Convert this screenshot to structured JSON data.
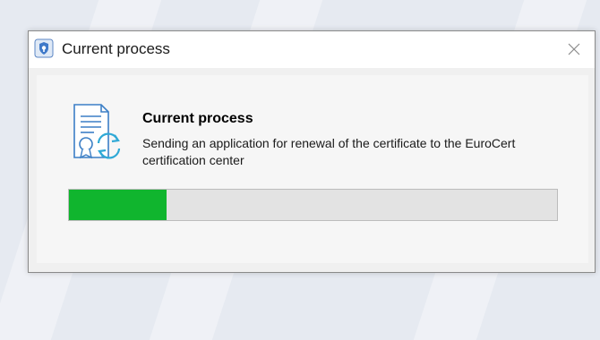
{
  "window": {
    "title": "Current process",
    "icon": "app-shield-icon"
  },
  "content": {
    "heading": "Current process",
    "message": "Sending an application for renewal of the certificate to the EuroCert certification center",
    "icon": "certificate-renew-icon"
  },
  "progress": {
    "fraction": 0.2,
    "color": "#10b52e"
  },
  "controls": {
    "close_icon": "close-icon"
  }
}
